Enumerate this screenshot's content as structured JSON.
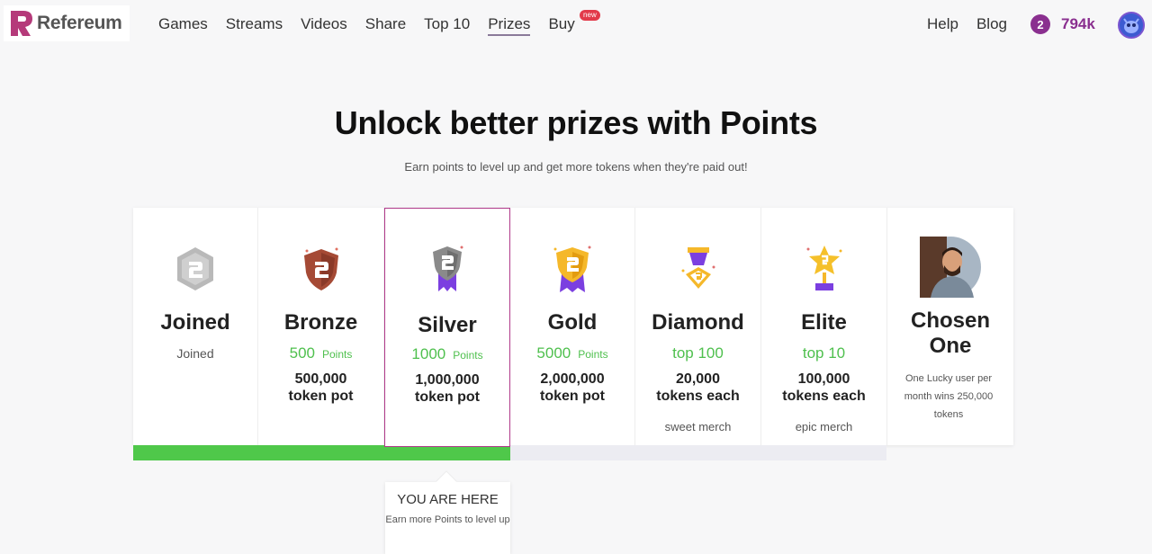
{
  "brand": {
    "name": "Refereum",
    "mark_color": "#b53a7a"
  },
  "nav": {
    "items": [
      {
        "label": "Games"
      },
      {
        "label": "Streams"
      },
      {
        "label": "Videos"
      },
      {
        "label": "Share"
      },
      {
        "label": "Top 10"
      },
      {
        "label": "Prizes",
        "active": true
      },
      {
        "label": "Buy",
        "badge": "new"
      }
    ],
    "right": [
      {
        "label": "Help"
      },
      {
        "label": "Blog"
      }
    ],
    "points_value": "794k",
    "coin_glyph": "2"
  },
  "hero": {
    "title": "Unlock better prizes with Points",
    "subtitle": "Earn points to level up and get more tokens when they're paid out!"
  },
  "tiers": [
    {
      "name": "Joined",
      "sub": "Joined",
      "icon": "gray-hexagon-icon"
    },
    {
      "name": "Bronze",
      "points": "500",
      "points_unit": "Points",
      "pot": [
        "500,000",
        "token pot"
      ],
      "icon": "bronze-shield-icon"
    },
    {
      "name": "Silver",
      "points": "1000",
      "points_unit": "Points",
      "pot": [
        "1,000,000",
        "token pot"
      ],
      "icon": "silver-ribbon-icon",
      "current": true
    },
    {
      "name": "Gold",
      "points": "5000",
      "points_unit": "Points",
      "pot": [
        "2,000,000",
        "token pot"
      ],
      "icon": "gold-ribbon-icon"
    },
    {
      "name": "Diamond",
      "rank": "top 100",
      "pot": [
        "20,000",
        "tokens each"
      ],
      "merch": "sweet merch",
      "icon": "diamond-medal-icon"
    },
    {
      "name": "Elite",
      "rank": "top 10",
      "pot": [
        "100,000",
        "tokens each"
      ],
      "merch": "epic merch",
      "icon": "star-trophy-icon"
    },
    {
      "name": [
        "Chosen",
        "One"
      ],
      "desc": "One Lucky user per month wins 250,000 tokens",
      "icon": "user-photo"
    }
  ],
  "progress": {
    "fraction": 0.5
  },
  "you_are_here": {
    "title": "YOU ARE HERE",
    "sub": "Earn more Points to level up"
  },
  "colors": {
    "accent_green": "#4fc84a",
    "accent_purple": "#8a2f8f",
    "current_border": "#b03a8a"
  }
}
